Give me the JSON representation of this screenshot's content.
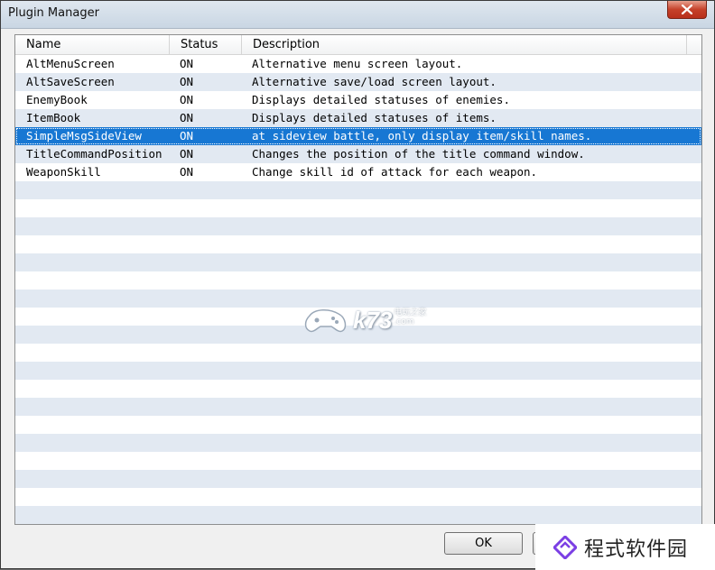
{
  "window": {
    "title": "Plugin Manager"
  },
  "columns": {
    "name": "Name",
    "status": "Status",
    "description": "Description"
  },
  "plugins": [
    {
      "name": "AltMenuScreen",
      "status": "ON",
      "description": "Alternative menu screen layout."
    },
    {
      "name": "AltSaveScreen",
      "status": "ON",
      "description": "Alternative save/load screen layout."
    },
    {
      "name": "EnemyBook",
      "status": "ON",
      "description": "Displays detailed statuses of enemies."
    },
    {
      "name": "ItemBook",
      "status": "ON",
      "description": "Displays detailed statuses of items."
    },
    {
      "name": "SimpleMsgSideView",
      "status": "ON",
      "description": "at sideview battle, only display item/skill names.",
      "selected": true
    },
    {
      "name": "TitleCommandPosition",
      "status": "ON",
      "description": "Changes the position of the title command window."
    },
    {
      "name": "WeaponSkill",
      "status": "ON",
      "description": "Change skill id of attack for each weapon."
    }
  ],
  "buttons": {
    "ok": "OK",
    "cancel": ""
  },
  "watermark": {
    "logo": "k73",
    "sub": "电玩之家",
    "domain": ".com"
  },
  "brand": {
    "name": "程式软件园"
  },
  "colors": {
    "selection": "#1777d3",
    "stripe": "#e2e9f2",
    "close": "#c5412a"
  }
}
